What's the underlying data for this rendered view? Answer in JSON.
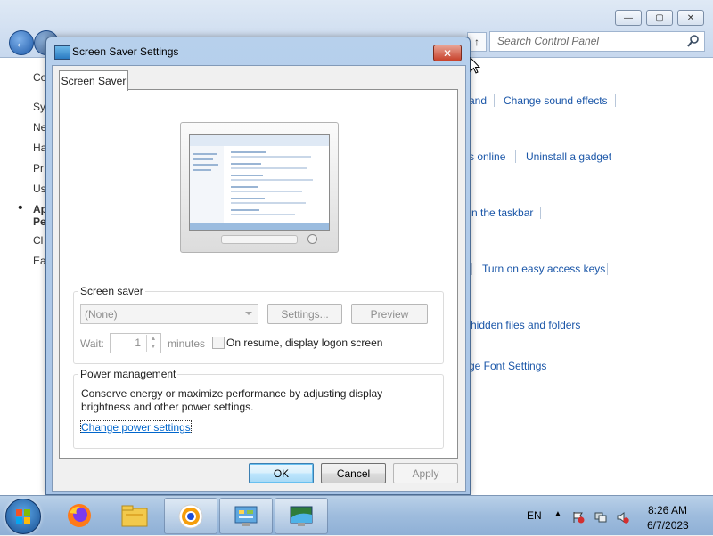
{
  "background_window": {
    "search_placeholder": "Search Control Panel",
    "left_items": [
      "Co",
      "Sy",
      "Ne",
      "Ha",
      "Pr",
      "Us",
      "Ap",
      "Pe",
      "Cl",
      "Ea"
    ],
    "links": [
      "and",
      "Change sound effects",
      "s online",
      "Uninstall a gadget",
      "n the taskbar",
      "Turn on easy access keys",
      "hidden files and folders",
      "ge Font Settings"
    ]
  },
  "dialog": {
    "title": "Screen Saver Settings",
    "close_glyph": "✕",
    "tab": "Screen Saver",
    "screen_saver": {
      "group_title": "Screen saver",
      "selected": "(None)",
      "settings_button": "Settings...",
      "preview_button": "Preview",
      "wait_label": "Wait:",
      "wait_value": "1",
      "minutes_label": "minutes",
      "resume_label": "On resume, display logon screen",
      "resume_checked": false
    },
    "power": {
      "group_title": "Power management",
      "description_line1": "Conserve energy or maximize performance by adjusting display",
      "description_line2": "brightness and other power settings.",
      "link": "Change power settings"
    },
    "buttons": {
      "ok": "OK",
      "cancel": "Cancel",
      "apply": "Apply"
    }
  },
  "taskbar": {
    "language": "EN",
    "time": "8:26 AM",
    "date": "6/7/2023",
    "apps": [
      "start-orb",
      "firefox-icon",
      "file-explorer-icon",
      "chromium-icon",
      "control-panel-icon",
      "screen-saver-icon"
    ],
    "active_app": "screen-saver-icon"
  },
  "colors": {
    "link": "#1a56a8",
    "dialog_frame": "#a7c3e5",
    "close_button": "#c7412b",
    "taskbar": "#9ebcdd"
  }
}
